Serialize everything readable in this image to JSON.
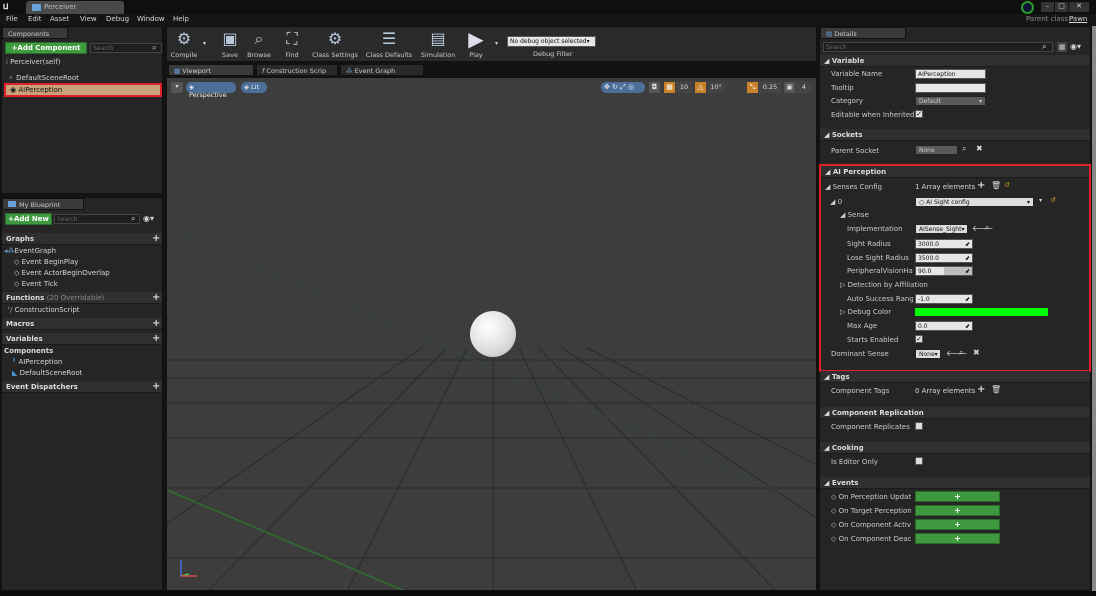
{
  "titlebar": {
    "tab": "Perceiver",
    "parent_class_label": "Parent class:",
    "parent_class_value": "Pawn"
  },
  "menu": [
    "File",
    "Edit",
    "Asset",
    "View",
    "Debug",
    "Window",
    "Help"
  ],
  "components_panel": {
    "title": "Components",
    "add_button": "+Add Component",
    "search_placeholder": "Search",
    "root": "Perceiver(self)",
    "items": [
      "DefaultSceneRoot",
      "AIPerception"
    ]
  },
  "my_blueprint": {
    "title": "My Blueprint",
    "add_button": "+Add New",
    "search_placeholder": "Search",
    "graphs_label": "Graphs",
    "event_graph": "EventGraph",
    "events": [
      "Event BeginPlay",
      "Event ActorBeginOverlap",
      "Event Tick"
    ],
    "functions_label": "Functions",
    "functions_overridable": "(20 Overridable)",
    "function_items": [
      "ConstructionScript"
    ],
    "macros_label": "Macros",
    "variables_label": "Variables",
    "components_label": "Components",
    "component_vars": [
      "AIPerception",
      "DefaultSceneRoot"
    ],
    "dispatchers_label": "Event Dispatchers"
  },
  "toolbar": {
    "buttons": [
      "Compile",
      "Save",
      "Browse",
      "Find",
      "Class Settings",
      "Class Defaults",
      "Simulation",
      "Play"
    ],
    "debug_select": "No debug object selected",
    "debug_filter": "Debug Filter"
  },
  "editor_tabs": [
    "Viewport",
    "Construction Scrip",
    "Event Graph"
  ],
  "viewport": {
    "perspective": "Perspective",
    "lit": "Lit",
    "grid_snap": "10",
    "rot_snap": "10°",
    "scale_snap": "0.25",
    "cam_speed": "4"
  },
  "details": {
    "title": "Details",
    "search_placeholder": "Search",
    "variable": {
      "section": "Variable",
      "name_label": "Variable Name",
      "name_value": "AIPerception",
      "tooltip_label": "Tooltip",
      "tooltip_value": "",
      "category_label": "Category",
      "category_value": "Default",
      "editable_label": "Editable when Inherited"
    },
    "sockets": {
      "section": "Sockets",
      "parent_label": "Parent Socket",
      "parent_value": "None"
    },
    "ai_perception": {
      "section": "AI Perception",
      "senses_label": "Senses Config",
      "senses_value": "1 Array elements",
      "index_label": "0",
      "index_value": "AI Sight config",
      "sense_label": "Sense",
      "impl_label": "Implementation",
      "impl_value": "AISense_Sight",
      "sight_radius_label": "Sight Radius",
      "sight_radius_value": "3000.0",
      "lose_sight_label": "Lose Sight Radius",
      "lose_sight_value": "3500.0",
      "peripheral_label": "PeripheralVisionHalfAr",
      "peripheral_value": "90.0",
      "detection_label": "Detection by Affiliation",
      "auto_success_label": "Auto Success Range fr",
      "auto_success_value": "-1.0",
      "debug_color_label": "Debug Color",
      "debug_color": "#00ff00",
      "max_age_label": "Max Age",
      "max_age_value": "0.0",
      "starts_enabled_label": "Starts Enabled",
      "dominant_label": "Dominant Sense",
      "dominant_value": "None"
    },
    "tags": {
      "section": "Tags",
      "label": "Component Tags",
      "value": "0 Array elements"
    },
    "replication": {
      "section": "Component Replication",
      "label": "Component Replicates"
    },
    "cooking": {
      "section": "Cooking",
      "label": "Is Editor Only"
    },
    "events": {
      "section": "Events",
      "items": [
        "On Perception Updated",
        "On Target Perception Up",
        "On Component Activate",
        "On Component Deactiva"
      ],
      "add_symbol": "+"
    }
  },
  "colors": {
    "highlight": "#e0202a",
    "accent_green": "#3f9a3f",
    "selection": "#c9a27a"
  }
}
